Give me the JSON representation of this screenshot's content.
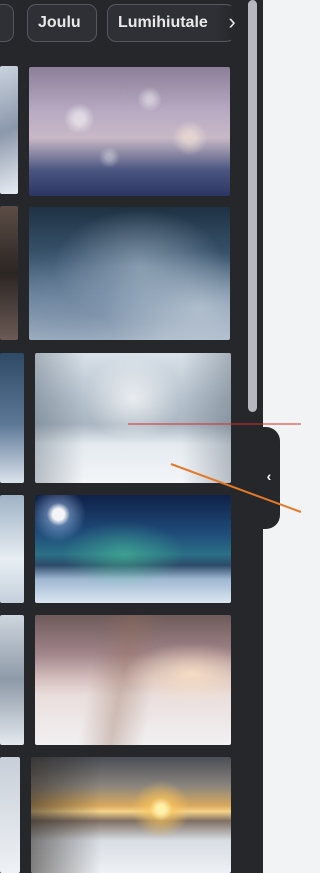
{
  "category_tabs": [
    {
      "label": ""
    },
    {
      "label": "Joulu"
    },
    {
      "label": "Lumihiutale"
    }
  ],
  "icons": {
    "scroll_right": "chevron-right-icon",
    "collapse": "chevron-left-icon"
  },
  "glyphs": {
    "next": "›",
    "collapse": "‹"
  },
  "photos": [
    {
      "subject": "snow-bokeh"
    },
    {
      "subject": "frosted-branches"
    },
    {
      "subject": "snowy-forest-path"
    },
    {
      "subject": "aurora-over-snow"
    },
    {
      "subject": "frosted-grass"
    },
    {
      "subject": "sunset-snowfield"
    }
  ],
  "colors": {
    "panel": "#26272b",
    "chip_bg": "#2f3035",
    "scroll_thumb": "#b7b8bd",
    "annotation_red": "#d22f25",
    "annotation_orange": "#e27a2a"
  }
}
